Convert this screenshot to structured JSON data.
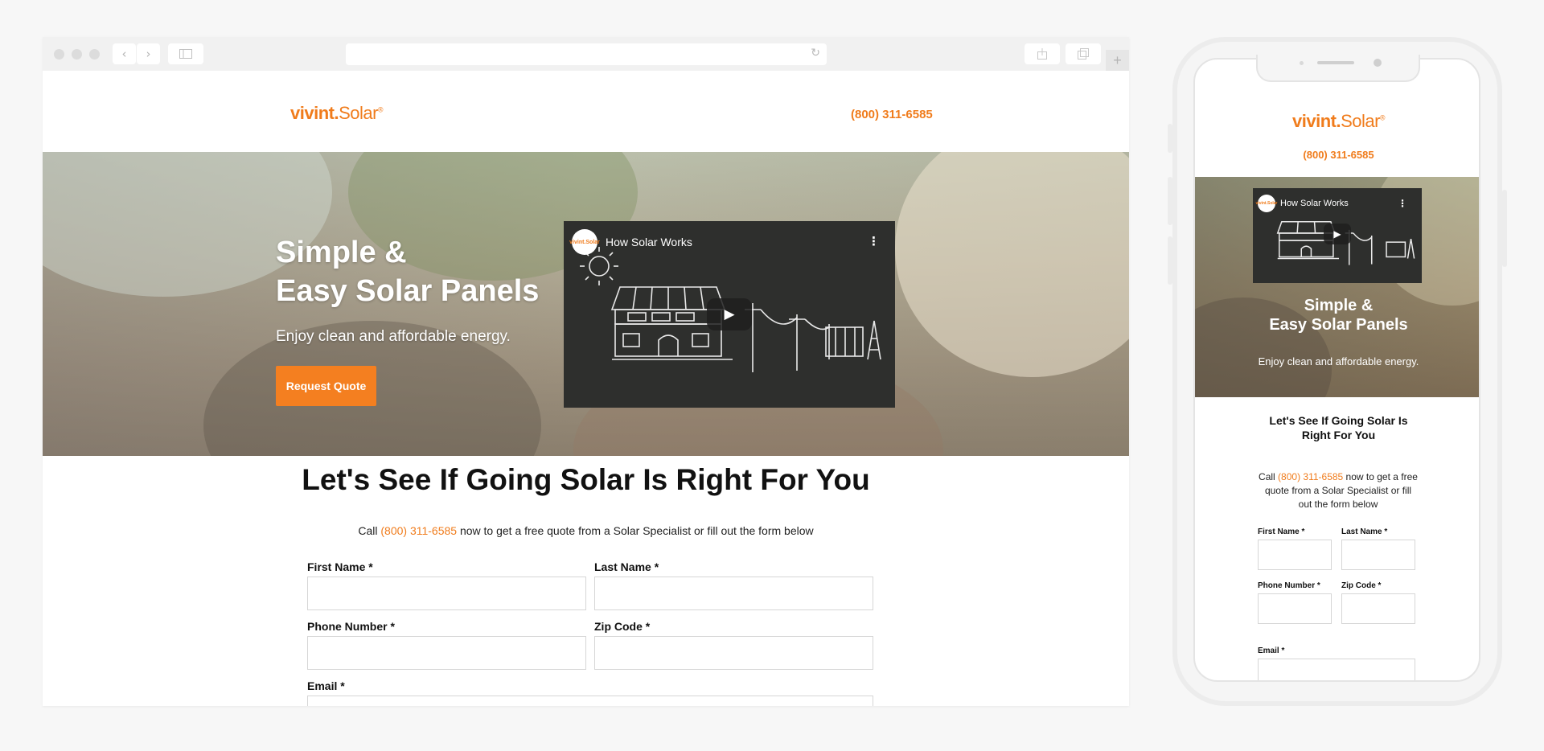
{
  "brand": {
    "logo_main": "vivint",
    "logo_dot": ".",
    "logo_secondary": "Solar",
    "logo_tm": "®",
    "accent_color": "#f07c1c"
  },
  "header": {
    "phone": "(800) 311-6585"
  },
  "browser": {
    "back_icon": "chevron-left-icon",
    "forward_icon": "chevron-right-icon",
    "sidebar_icon": "sidebar-icon",
    "reload_icon": "reload-icon",
    "share_icon": "share-icon",
    "tabs_icon": "tabs-icon",
    "new_tab_label": "+"
  },
  "hero": {
    "title_line1": "Simple &",
    "title_line2": "Easy Solar Panels",
    "subtitle": "Enjoy clean and affordable energy.",
    "cta_label": "Request Quote"
  },
  "video": {
    "title": "How Solar Works",
    "channel_logo": "vivint.Solar",
    "menu_icon": "more-vertical-icon",
    "play_icon": "play-icon"
  },
  "section": {
    "title": "Let's See If Going Solar Is Right For You",
    "sub_prefix": "Call ",
    "sub_phone": "(800) 311-6585",
    "sub_suffix": " now to get a free quote from a Solar Specialist or fill out the form below"
  },
  "form": {
    "first_name_label": "First Name *",
    "last_name_label": "Last Name *",
    "phone_label": "Phone Number *",
    "zip_label": "Zip Code *",
    "email_label": "Email *"
  },
  "mobile": {
    "section_title_line1": "Let's See If Going Solar Is",
    "section_title_line2": "Right For You"
  }
}
